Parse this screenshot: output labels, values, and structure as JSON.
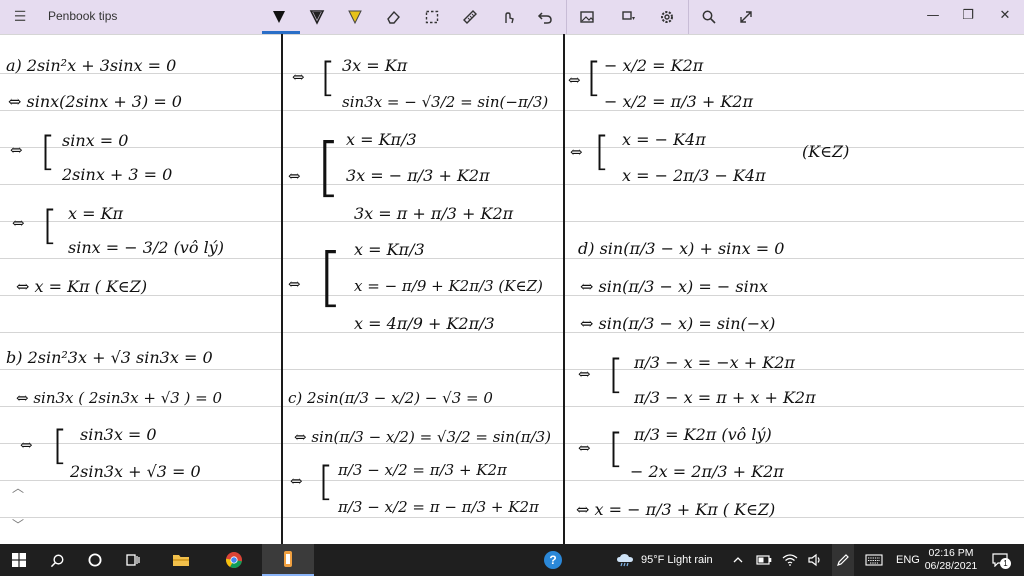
{
  "app": {
    "title": "Penbook tips"
  },
  "toolbar": {
    "tools": [
      "pen-black-icon",
      "pen-dark-icon",
      "highlighter-icon",
      "eraser-icon",
      "lasso-icon",
      "ruler-icon",
      "touch-write-icon",
      "undo-icon",
      "image-icon",
      "shapes-icon",
      "settings-icon",
      "search-icon",
      "expand-icon"
    ]
  },
  "window": {
    "minimize": "—",
    "maximize": "❐",
    "close": "✕"
  },
  "notes": {
    "col1": [
      "a) 2sin²x  +  3sinx  =  0",
      "⇔  sinx(2sinx + 3)  = 0",
      "sinx  = 0",
      "2sinx + 3 = 0",
      "x  =  Kπ",
      "sinx = − 3/2  (vô lý)",
      "⇔   x  =  Kπ   ( K∈Z)",
      "b) 2sin²3x  +  √3  sin3x  =  0",
      "⇔  sin3x ( 2sin3x  + √3 )  = 0",
      "sin3x  =  0",
      "2sin3x  +  √3  =  0"
    ],
    "col2": [
      "3x  =  Kπ",
      "sin3x  =  − √3/2  = sin(−π/3)",
      "x  =  Kπ/3",
      "3x  =  − π/3  + K2π",
      "3x  =  π  +  π/3  +  K2π",
      "x  =  Kπ/3",
      "x  =  − π/9  +  K2π/3  (K∈Z)",
      "x  =  4π/9  +  K2π/3",
      "c)  2sin(π/3 − x/2)  −  √3  =  0",
      "⇔  sin(π/3 − x/2)  =  √3/2  = sin(π/3)",
      "π/3 − x/2  =  π/3  + K2π",
      "π/3 − x/2  =  π − π/3  + K2π"
    ],
    "col3": [
      "− x/2  =  K2π",
      "− x/2  =  π/3  + K2π",
      "x  =  − K4π",
      "x  =  − 2π/3  −  K4π",
      "(K∈Z)",
      "d) sin(π/3 − x)  +  sinx  = 0",
      "⇔  sin(π/3 − x)  =  − sinx",
      "⇔  sin(π/3 − x)  =  sin(−x)",
      "π/3 − x  =  −x  + K2π",
      "π/3 − x  =  π + x + K2π",
      "π/3  = K2π  (vô lý)",
      "− 2x  =  2π/3  +  K2π",
      "⇔   x  =  − π/3  +  Kπ   ( K∈Z)"
    ]
  },
  "taskbar": {
    "apps": [
      "windows-start-icon",
      "search-icon",
      "cortana-icon",
      "task-view-icon",
      "file-explorer-icon",
      "chrome-icon",
      "penbook-icon"
    ],
    "help": "?",
    "weather": "95°F  Light rain",
    "language": "ENG",
    "time": "02:16 PM",
    "date": "06/28/2021",
    "notifications": "1"
  }
}
